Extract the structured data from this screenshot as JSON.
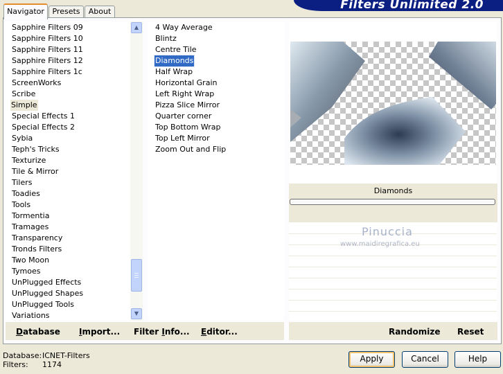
{
  "tabs": [
    "Navigator",
    "Presets",
    "About"
  ],
  "banner": "Filters Unlimited 2.0",
  "categories": [
    "Sapphire Filters 09",
    "Sapphire Filters 10",
    "Sapphire Filters 11",
    "Sapphire Filters 12",
    "Sapphire Filters 1c",
    "ScreenWorks",
    "Scribe",
    "Simple",
    "Special Effects 1",
    "Special Effects 2",
    "Sybia",
    "Teph's Tricks",
    "Texturize",
    "Tile & Mirror",
    "Tilers",
    "Toadies",
    "Tools",
    "Tormentia",
    "Tramages",
    "Transparency",
    "Tronds Filters",
    "Two Moon",
    "Tymoes",
    "UnPlugged Effects",
    "UnPlugged Shapes",
    "UnPlugged Tools",
    "Variations"
  ],
  "selected_category": "Simple",
  "filters": [
    "4 Way Average",
    "Blintz",
    "Centre Tile",
    "Diamonds",
    "Half Wrap",
    "Horizontal Grain",
    "Left Right Wrap",
    "Pizza Slice Mirror",
    "Quarter corner",
    "Top Bottom Wrap",
    "Top Left Mirror",
    "Zoom Out and Flip"
  ],
  "selected_filter": "Diamonds",
  "filter_name": "Diamonds",
  "watermark": {
    "name": "Pinuccia",
    "site": "www.maidiregrafica.eu"
  },
  "left_buttons": [
    {
      "label": "Database",
      "underline": "D",
      "rest": "atabase"
    },
    {
      "label": "Import...",
      "underline": "I",
      "rest": "mport..."
    },
    {
      "label": "Filter Info...",
      "pre": "Filter ",
      "underline": "I",
      "rest": "nfo..."
    },
    {
      "label": "Editor...",
      "underline": "E",
      "rest": "ditor..."
    }
  ],
  "right_buttons": {
    "randomize": "Randomize",
    "reset": "Reset"
  },
  "status": {
    "db_label": "Database:",
    "db_value": "ICNET-Filters",
    "filters_label": "Filters:",
    "filters_value": "1174"
  },
  "dialog_buttons": {
    "apply": "Apply",
    "cancel": "Cancel",
    "help": "Help"
  }
}
